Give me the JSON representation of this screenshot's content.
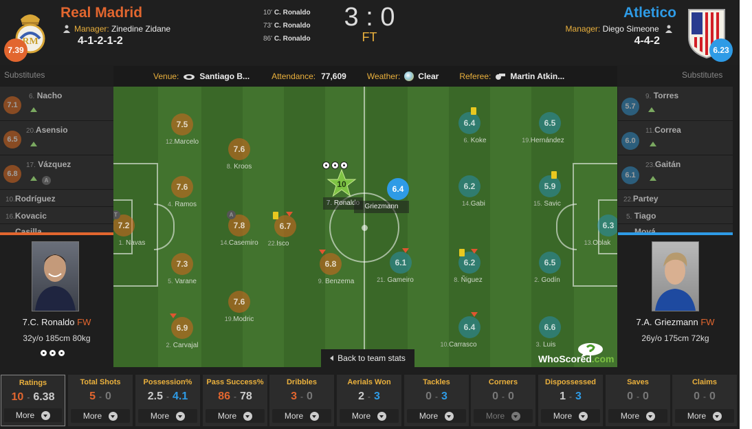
{
  "home": {
    "name": "Real Madrid",
    "manager_label": "Manager:",
    "manager": "Zinedine Zidane",
    "formation": "4-1-2-1-2",
    "rating": "7.39",
    "color": "#e2662f"
  },
  "away": {
    "name": "Atletico",
    "manager_label": "Manager:",
    "manager": "Diego Simeone",
    "formation": "4-4-2",
    "rating": "6.23",
    "color": "#2e9be6"
  },
  "score": {
    "value": "3 : 0",
    "status": "FT"
  },
  "goals": [
    {
      "minute": "10'",
      "player": "C. Ronaldo"
    },
    {
      "minute": "73'",
      "player": "C. Ronaldo"
    },
    {
      "minute": "86'",
      "player": "C. Ronaldo"
    }
  ],
  "info": {
    "venue_label": "Venue:",
    "venue": "Santiago B...",
    "attendance_label": "Attendance:",
    "attendance": "77,609",
    "weather_label": "Weather:",
    "weather": "Clear",
    "referee_label": "Referee:",
    "referee": "Martin Atkin..."
  },
  "substitutes_label": "Substitutes",
  "home_subs": [
    {
      "num": "6.",
      "name": "Nacho",
      "rating": "7.1"
    },
    {
      "num": "20.",
      "name": "Asensio",
      "rating": "6.5"
    },
    {
      "num": "17.",
      "name": "Vázquez",
      "rating": "6.8"
    },
    {
      "num": "10.",
      "name": "Rodríguez"
    },
    {
      "num": "16.",
      "name": "Kovacic"
    },
    {
      "num": "",
      "name": "Casilla"
    }
  ],
  "away_subs": [
    {
      "num": "9.",
      "name": "Torres",
      "rating": "5.7"
    },
    {
      "num": "11.",
      "name": "Correa",
      "rating": "6.0"
    },
    {
      "num": "23.",
      "name": "Gaitán",
      "rating": "6.1"
    },
    {
      "num": "22.",
      "name": "Partey"
    },
    {
      "num": "5.",
      "name": "Tiago"
    },
    {
      "num": "",
      "name": "Moyá"
    }
  ],
  "home_players": [
    {
      "num": "12.",
      "name": "Marcelo",
      "rating": "7.5"
    },
    {
      "num": "8.",
      "name": "Kroos",
      "rating": "7.6"
    },
    {
      "num": "4.",
      "name": "Ramos",
      "rating": "7.6"
    },
    {
      "num": "1.",
      "name": "Navas",
      "rating": "7.2"
    },
    {
      "num": "14.",
      "name": "Casemiro",
      "rating": "7.8"
    },
    {
      "num": "22.",
      "name": "Isco",
      "rating": "6.7"
    },
    {
      "num": "5.",
      "name": "Varane",
      "rating": "7.3"
    },
    {
      "num": "9.",
      "name": "Benzema",
      "rating": "6.8"
    },
    {
      "num": "19.",
      "name": "Modric",
      "rating": "7.6"
    },
    {
      "num": "2.",
      "name": "Carvajal",
      "rating": "6.9"
    },
    {
      "num": "7.",
      "name": "Ronaldo",
      "rating": "10"
    }
  ],
  "away_players": [
    {
      "num": "6.",
      "name": "Koke",
      "rating": "6.4"
    },
    {
      "num": "19.",
      "name": "Hernández",
      "rating": "6.5"
    },
    {
      "num": "14.",
      "name": "Gabi",
      "rating": "6.2"
    },
    {
      "num": "15.",
      "name": "Savic",
      "rating": "5.9"
    },
    {
      "num": "13.",
      "name": "Oblak",
      "rating": "6.3"
    },
    {
      "num": "21.",
      "name": "Gameiro",
      "rating": "6.1"
    },
    {
      "num": "8.",
      "name": "Ñiguez",
      "rating": "6.2"
    },
    {
      "num": "2.",
      "name": "Godín",
      "rating": "6.5"
    },
    {
      "num": "10.",
      "name": "Carrasco",
      "rating": "6.4"
    },
    {
      "num": "3.",
      "name": "Luis",
      "rating": "6.6"
    },
    {
      "num": "",
      "name": "Griezmann",
      "rating": "6.4"
    }
  ],
  "home_star": {
    "name": "7.C. Ronaldo",
    "pos": "FW",
    "age": "32",
    "age_unit": "y/o",
    "height": "185",
    "height_unit": "cm",
    "weight": "80",
    "weight_unit": "kg"
  },
  "away_star": {
    "name": "7.A. Griezmann",
    "pos": "FW",
    "age": "26",
    "age_unit": "y/o",
    "height": "175",
    "height_unit": "cm",
    "weight": "72",
    "weight_unit": "kg"
  },
  "back_label": "Back to team stats",
  "brand": {
    "who": "WhoScored",
    "dot": ".com"
  },
  "more_label": "More",
  "stats": [
    {
      "title": "Ratings",
      "home": "10",
      "away": "6.38",
      "lead": "home"
    },
    {
      "title": "Total Shots",
      "home": "5",
      "away": "0",
      "lead": "home"
    },
    {
      "title": "Possession%",
      "home": "2.5",
      "away": "4.1",
      "lead": "away"
    },
    {
      "title": "Pass Success%",
      "home": "86",
      "away": "78",
      "lead": "home"
    },
    {
      "title": "Dribbles",
      "home": "3",
      "away": "0",
      "lead": "home"
    },
    {
      "title": "Aerials Won",
      "home": "2",
      "away": "3",
      "lead": "away"
    },
    {
      "title": "Tackles",
      "home": "0",
      "away": "3",
      "lead": "away"
    },
    {
      "title": "Corners",
      "home": "0",
      "away": "0",
      "lead": "none"
    },
    {
      "title": "Dispossessed",
      "home": "1",
      "away": "3",
      "lead": "away"
    },
    {
      "title": "Saves",
      "home": "0",
      "away": "0",
      "lead": "none"
    },
    {
      "title": "Claims",
      "home": "0",
      "away": "0",
      "lead": "none"
    }
  ]
}
